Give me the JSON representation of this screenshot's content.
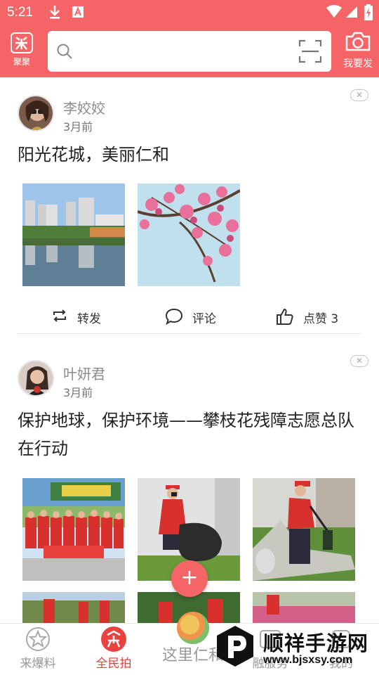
{
  "status_bar": {
    "time": "5:21"
  },
  "header": {
    "logo_label": "聚聚",
    "search_placeholder": "",
    "post_label": "我要发"
  },
  "posts": [
    {
      "author": "李姣姣",
      "time": "3月前",
      "close": "✕",
      "title": "阳光花城，美丽仁和",
      "actions": {
        "repost": "转发",
        "comment": "评论",
        "like": "点赞 3"
      }
    },
    {
      "author": "叶妍君",
      "time": "3月前",
      "close": "✕",
      "title": "保护地球，保护环境——攀枝花残障志愿总队在行动"
    }
  ],
  "fab": "+",
  "tabs": [
    {
      "label": "来爆料"
    },
    {
      "label": "全民拍"
    },
    {
      "label": "这里仁和"
    },
    {
      "label": "融服务"
    },
    {
      "label": "我的"
    }
  ],
  "watermark": {
    "text": "顺祥手游网",
    "url": "www.bjsxsy.com"
  },
  "colors": {
    "accent": "#f56567",
    "active_tab": "#e8433e"
  }
}
